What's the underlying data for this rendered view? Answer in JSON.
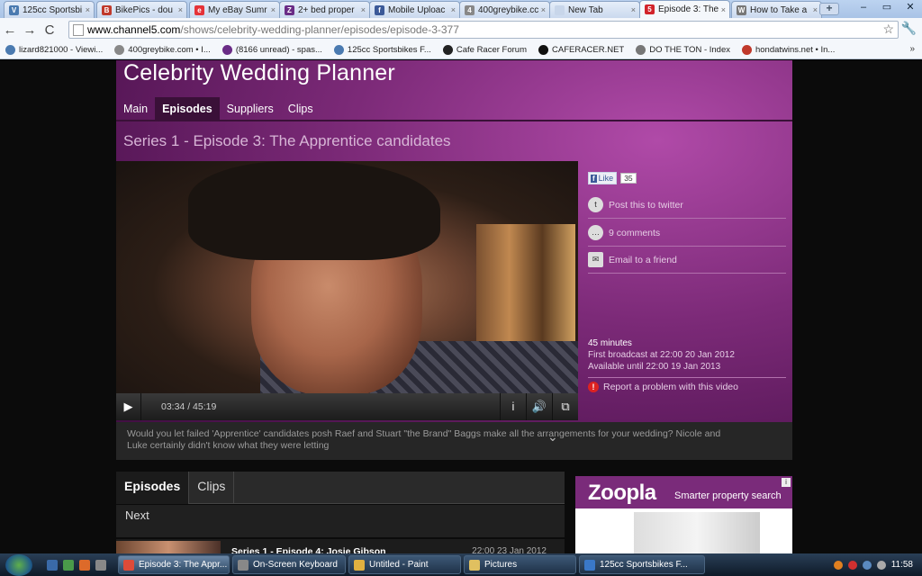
{
  "browser": {
    "tabs": [
      {
        "title": "125cc Sportsbi",
        "icon_color": "#4a7ab0",
        "glyph": "V"
      },
      {
        "title": "BikePics - dou",
        "icon_color": "#c0392b",
        "glyph": "B"
      },
      {
        "title": "My eBay Sumr",
        "icon_color": "#e53238",
        "glyph": "e"
      },
      {
        "title": "2+ bed proper",
        "icon_color": "#6a2c86",
        "glyph": "Z"
      },
      {
        "title": "Mobile Uploac",
        "icon_color": "#3b5998",
        "glyph": "f"
      },
      {
        "title": "400greybike.cc",
        "icon_color": "#888888",
        "glyph": "4"
      },
      {
        "title": "New Tab",
        "icon_color": "#c8d6ea",
        "glyph": ""
      },
      {
        "title": "Episode 3: The",
        "icon_color": "#d2232a",
        "glyph": "5"
      },
      {
        "title": "How to Take a",
        "icon_color": "#777777",
        "glyph": "W"
      }
    ],
    "new_tab": "+",
    "window_controls": [
      "–",
      "▭",
      "✕"
    ],
    "url_host": "www.channel5.com",
    "url_path": "/shows/celebrity-wedding-planner/episodes/episode-3-377",
    "star": "☆",
    "wrench": "🔧",
    "nav": {
      "back": "←",
      "forward": "→",
      "reload": "C"
    },
    "bookmarks": [
      {
        "label": "lizard821000 - Viewi...",
        "color": "#4a7ab0"
      },
      {
        "label": "400greybike.com • I...",
        "color": "#888888"
      },
      {
        "label": "(8166 unread) - spas...",
        "color": "#6a2c86"
      },
      {
        "label": "125cc Sportsbikes F...",
        "color": "#4a7ab0"
      },
      {
        "label": "Cafe Racer Forum",
        "color": "#222222"
      },
      {
        "label": "CAFERACER.NET",
        "color": "#111111"
      },
      {
        "label": "DO THE TON - Index",
        "color": "#777777"
      },
      {
        "label": "hondatwins.net • In...",
        "color": "#c0392b"
      }
    ],
    "bookmarks_more": "»"
  },
  "page": {
    "site_title": "Celebrity Wedding Planner",
    "nav": [
      {
        "label": "Main",
        "active": false
      },
      {
        "label": "Episodes",
        "active": true
      },
      {
        "label": "Suppliers",
        "active": false
      },
      {
        "label": "Clips",
        "active": false
      }
    ],
    "episode_title": "Series 1 - Episode 3: The Apprentice candidates",
    "player": {
      "time": "03:34 / 45:19",
      "play_icon": "▶",
      "info_icon": "i",
      "volume_icon": "🔊",
      "fullscreen_icon": "⧉"
    },
    "side": {
      "fb_like": "Like",
      "fb_count": "35",
      "twitter": "Post this to twitter",
      "comments": "9 comments",
      "email": "Email to a friend",
      "duration": "45 minutes",
      "first_broadcast": "First broadcast at 22:00 20 Jan 2012",
      "available_until": "Available until 22:00 19 Jan 2013",
      "report": "Report a problem with this video"
    },
    "description": "Would you let failed 'Apprentice' candidates posh Raef and Stuart \"the Brand\" Baggs make all the arrangements for your wedding? Nicole and Luke certainly didn't know what they were letting",
    "desc_chevron": "⌄",
    "lower_tabs": [
      "Episodes",
      "Clips"
    ],
    "next_label": "Next",
    "next_episode": {
      "title": "Series 1 - Episode 4: Josie Gibson",
      "date": "22:00 23 Jan 2012"
    },
    "ad": {
      "logo": "Zoopla",
      "tagline": "Smarter property search",
      "info": "i"
    }
  },
  "taskbar": {
    "items": [
      {
        "label": "Episode 3: The Appr...",
        "active": true,
        "color": "#dd4b39"
      },
      {
        "label": "On-Screen Keyboard",
        "active": false,
        "color": "#888888"
      },
      {
        "label": "Untitled - Paint",
        "active": false,
        "color": "#e0b040"
      },
      {
        "label": "Pictures",
        "active": false,
        "color": "#e0c060"
      },
      {
        "label": "125cc Sportsbikes F...",
        "active": false,
        "color": "#3a78c8"
      }
    ],
    "clock": "11:58"
  }
}
